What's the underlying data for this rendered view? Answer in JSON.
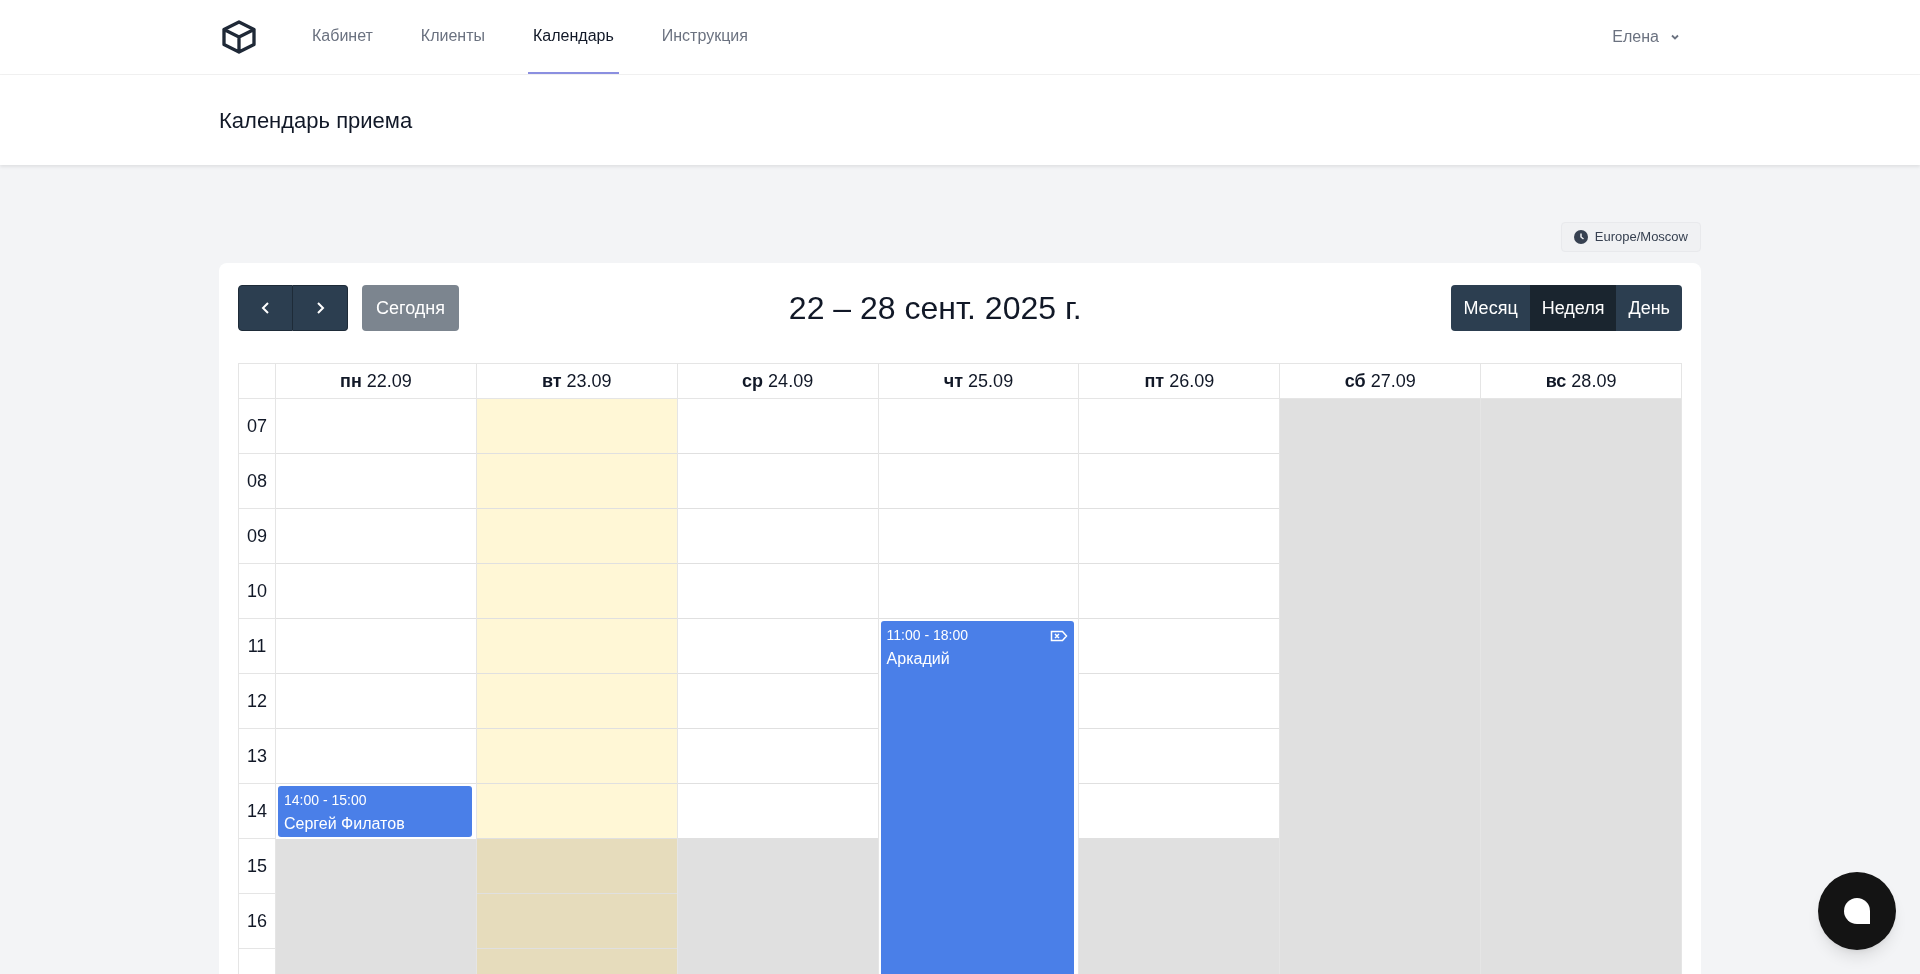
{
  "nav": {
    "items": [
      {
        "label": "Кабинет",
        "selected": false
      },
      {
        "label": "Клиенты",
        "selected": false
      },
      {
        "label": "Календарь",
        "selected": true
      },
      {
        "label": "Инструкция",
        "selected": false
      }
    ],
    "user": "Елена"
  },
  "page_title": "Календарь приема",
  "timezone": "Europe/Moscow",
  "toolbar": {
    "today_button": {
      "label": "Сегодня",
      "disabled": true
    },
    "range_title": "22 – 28 сент. 2025 г.",
    "views": [
      {
        "label": "Месяц",
        "selected": false
      },
      {
        "label": "Неделя",
        "selected": true
      },
      {
        "label": "День",
        "selected": false
      }
    ]
  },
  "hours": [
    {
      "label": "07",
      "working": true
    },
    {
      "label": "08",
      "working": true
    },
    {
      "label": "09",
      "working": true
    },
    {
      "label": "10",
      "working": true
    },
    {
      "label": "11",
      "working": true
    },
    {
      "label": "12",
      "working": true
    },
    {
      "label": "13",
      "working": true
    },
    {
      "label": "14",
      "working": true
    },
    {
      "label": "15",
      "working": false
    },
    {
      "label": "16",
      "working": false
    }
  ],
  "days": [
    {
      "label": "**пн** 22.09",
      "today": false,
      "working": true,
      "events": [
        {
          "time": "14:00 - 15:00",
          "title": "Сергей Филатов",
          "flagged": false
        }
      ]
    },
    {
      "label": "**вт** 23.09",
      "today": true,
      "working": true
    },
    {
      "label": "**ср** 24.09",
      "today": false,
      "working": true
    },
    {
      "label": "**чт** 25.09",
      "today": false,
      "working": true,
      "events": [
        {
          "time": "11:00 - 18:00",
          "title": "Аркадий",
          "flagged": true
        }
      ]
    },
    {
      "label": "**пт** 26.09",
      "today": false,
      "working": true
    },
    {
      "label": "**сб** 27.09",
      "today": false,
      "working": false
    },
    {
      "label": "**вс** 28.09",
      "today": false,
      "working": false
    }
  ]
}
